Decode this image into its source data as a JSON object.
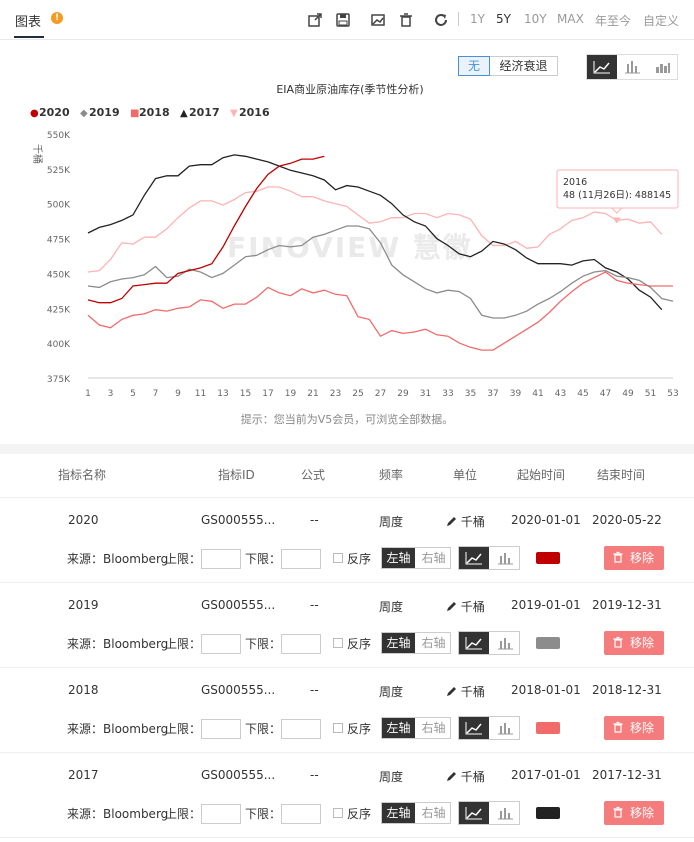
{
  "header": {
    "tab_label": "图表",
    "info_badge": "!",
    "tools": [
      "share-icon",
      "save-icon",
      "image-icon",
      "delete-icon",
      "refresh-icon"
    ],
    "ranges": [
      "1Y",
      "5Y",
      "10Y",
      "MAX",
      "年至今",
      "自定义"
    ],
    "active_range": "5Y"
  },
  "controls": {
    "overlay_none": "无",
    "overlay_recession": "经济衰退",
    "chart_types": [
      "line-chart-icon",
      "bar-chart-icon",
      "area-chart-icon"
    ]
  },
  "watermark": "FINOVIEW 慧徽",
  "tooltip": {
    "series": "2016",
    "text": "48 (11月26日): 488145"
  },
  "notice": "提示：您当前为V5会员，可浏览全部数据。",
  "table": {
    "headers": [
      "指标名称",
      "指标ID",
      "公式",
      "频率",
      "单位",
      "起始时间",
      "结束时间"
    ],
    "source_label": "来源：Bloomberg",
    "upper_label": "上限：",
    "lower_label": "下限：",
    "reverse_label": "反序",
    "left_axis": "左轴",
    "right_axis": "右轴",
    "remove_label": "移除",
    "rows": [
      {
        "name": "2020",
        "id": "GS000555...",
        "formula": "--",
        "freq": "周度",
        "unit": "千桶",
        "start": "2020-01-01",
        "end": "2020-05-22",
        "color": "#c00000"
      },
      {
        "name": "2019",
        "id": "GS000555...",
        "formula": "--",
        "freq": "周度",
        "unit": "千桶",
        "start": "2019-01-01",
        "end": "2019-12-31",
        "color": "#8c8c8c"
      },
      {
        "name": "2018",
        "id": "GS000555...",
        "formula": "--",
        "freq": "周度",
        "unit": "千桶",
        "start": "2018-01-01",
        "end": "2018-12-31",
        "color": "#f36a6a"
      },
      {
        "name": "2017",
        "id": "GS000555...",
        "formula": "--",
        "freq": "周度",
        "unit": "千桶",
        "start": "2017-01-01",
        "end": "2017-12-31",
        "color": "#222222"
      }
    ]
  },
  "chart_data": {
    "type": "line",
    "title": "EIA商业原油库存(季节性分析)",
    "ylabel": "千桶",
    "ylim": [
      375,
      550
    ],
    "yticks": [
      "375K",
      "400K",
      "425K",
      "450K",
      "475K",
      "500K",
      "525K",
      "550K"
    ],
    "ytick_values": [
      375,
      400,
      425,
      450,
      475,
      500,
      525,
      550
    ],
    "xlim": [
      1,
      53
    ],
    "xticks": [
      "1",
      "3",
      "5",
      "7",
      "9",
      "11",
      "13",
      "15",
      "17",
      "19",
      "21",
      "23",
      "25",
      "27",
      "29",
      "31",
      "33",
      "35",
      "37",
      "39",
      "41",
      "43",
      "45",
      "47",
      "49",
      "51",
      "53"
    ],
    "legend_position": "top-left",
    "series": [
      {
        "name": "2020",
        "color": "#c00000",
        "marker": "●",
        "values": [
          431,
          429,
          429,
          432,
          441,
          442,
          443,
          443,
          450,
          452,
          454,
          457,
          469,
          484,
          498,
          511,
          521,
          527,
          529,
          532,
          532,
          534
        ]
      },
      {
        "name": "2019",
        "color": "#8c8c8c",
        "marker": "◆",
        "values": [
          441,
          440,
          444,
          446,
          447,
          449,
          455,
          447,
          448,
          453,
          451,
          447,
          450,
          456,
          462,
          463,
          467,
          470,
          469,
          470,
          476,
          478,
          481,
          484,
          484,
          482,
          472,
          456,
          449,
          444,
          439,
          436,
          438,
          437,
          432,
          420,
          418,
          418,
          420,
          423,
          428,
          432,
          437,
          443,
          448,
          451,
          452,
          448,
          447,
          445,
          440,
          432,
          430
        ]
      },
      {
        "name": "2018",
        "color": "#f36a6a",
        "marker": "■",
        "values": [
          420,
          413,
          411,
          417,
          420,
          421,
          424,
          423,
          425,
          426,
          431,
          430,
          425,
          428,
          428,
          433,
          440,
          436,
          434,
          439,
          436,
          438,
          435,
          434,
          419,
          417,
          405,
          409,
          407,
          408,
          410,
          406,
          405,
          400,
          397,
          395,
          395,
          400,
          405,
          410,
          415,
          422,
          430,
          437,
          443,
          447,
          451,
          445,
          443,
          442,
          441,
          441,
          441
        ]
      },
      {
        "name": "2017",
        "color": "#222222",
        "marker": "▲",
        "values": [
          479,
          483,
          485,
          488,
          492,
          506,
          518,
          520,
          520,
          527,
          528,
          528,
          533,
          535,
          534,
          532,
          530,
          527,
          524,
          522,
          520,
          517,
          510,
          513,
          512,
          509,
          506,
          500,
          492,
          487,
          484,
          475,
          470,
          464,
          462,
          466,
          473,
          471,
          467,
          461,
          457,
          457,
          457,
          456,
          459,
          460,
          454,
          451,
          446,
          438,
          433,
          424
        ]
      },
      {
        "name": "2016",
        "color": "#ffb3b3",
        "marker": "▼",
        "values": [
          451,
          452,
          460,
          472,
          471,
          476,
          476,
          482,
          490,
          497,
          502,
          502,
          499,
          503,
          508,
          509,
          512,
          512,
          509,
          505,
          505,
          502,
          500,
          498,
          492,
          486,
          487,
          490,
          490,
          493,
          493,
          490,
          493,
          492,
          489,
          477,
          470,
          470,
          473,
          468,
          469,
          478,
          482,
          488,
          490,
          494,
          493,
          488,
          489,
          486,
          487,
          478
        ]
      }
    ]
  }
}
